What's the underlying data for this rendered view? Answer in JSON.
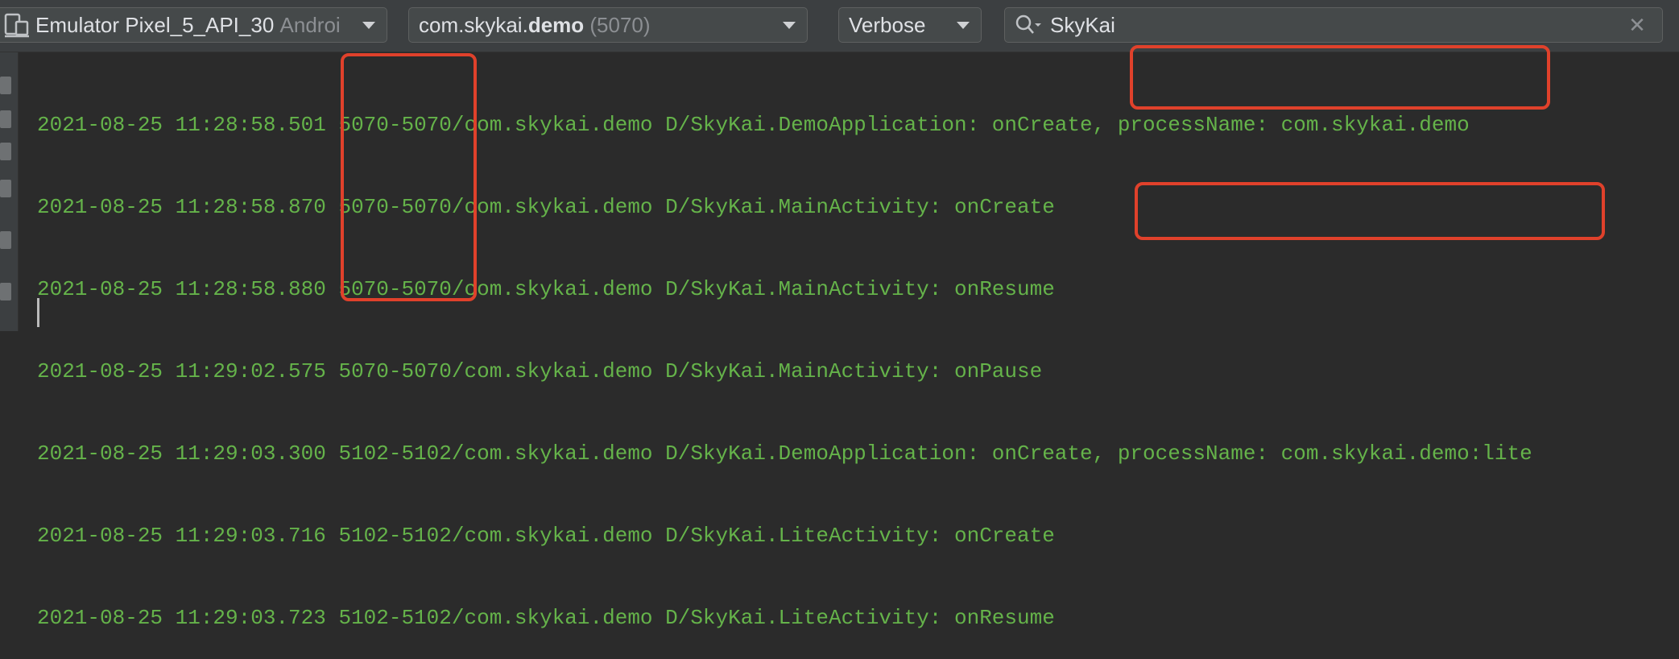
{
  "toolbar": {
    "device": {
      "label": "Emulator Pixel_5_API_30",
      "suffix": "Androi"
    },
    "process": {
      "name_prefix": "com.skykai.",
      "name_bold": "demo",
      "pid": "(5070)"
    },
    "level": {
      "label": "Verbose"
    },
    "search": {
      "value": "SkyKai",
      "clear": "✕"
    }
  },
  "log": {
    "lines": [
      "2021-08-25 11:28:58.501 5070-5070/com.skykai.demo D/SkyKai.DemoApplication: onCreate, processName: com.skykai.demo",
      "2021-08-25 11:28:58.870 5070-5070/com.skykai.demo D/SkyKai.MainActivity: onCreate",
      "2021-08-25 11:28:58.880 5070-5070/com.skykai.demo D/SkyKai.MainActivity: onResume",
      "2021-08-25 11:29:02.575 5070-5070/com.skykai.demo D/SkyKai.MainActivity: onPause",
      "2021-08-25 11:29:03.300 5102-5102/com.skykai.demo D/SkyKai.DemoApplication: onCreate, processName: com.skykai.demo:lite",
      "2021-08-25 11:29:03.716 5102-5102/com.skykai.demo D/SkyKai.LiteActivity: onCreate",
      "2021-08-25 11:29:03.723 5102-5102/com.skykai.demo D/SkyKai.LiteActivity: onResume"
    ]
  },
  "colors": {
    "background": "#2b2b2b",
    "toolbar": "#3c3f41",
    "log_text": "#65b34a",
    "highlight": "#e0412b"
  }
}
